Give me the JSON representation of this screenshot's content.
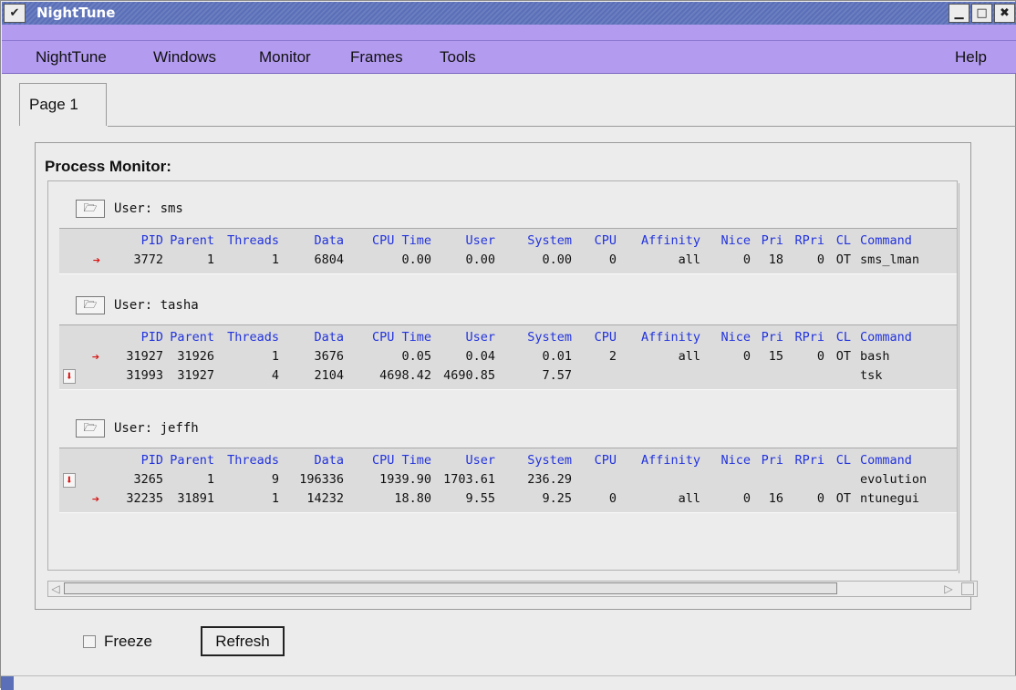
{
  "window": {
    "title": "NightTune",
    "menu_icon": "chevron-down-icon",
    "min_icon": "minimize-icon",
    "max_icon": "maximize-icon",
    "close_icon": "close-icon",
    "min_glyph": "▁",
    "max_glyph": "□",
    "close_glyph": "✖",
    "menu_glyph": "✔"
  },
  "menubar": {
    "items": [
      "NightTune",
      "Windows",
      "Monitor",
      "Frames",
      "Tools"
    ],
    "help": "Help"
  },
  "tabs": [
    {
      "label": "Page 1"
    }
  ],
  "process_monitor": {
    "title": "Process Monitor:",
    "columns": [
      "PID",
      "Parent",
      "Threads",
      "Data",
      "CPU Time",
      "User",
      "System",
      "CPU",
      "Affinity",
      "Nice",
      "Pri",
      "RPri",
      "CL",
      "Command"
    ],
    "groups": [
      {
        "user_label": "User: sms",
        "rows": [
          {
            "icon": "right-arrow-icon",
            "pid": "3772",
            "parent": "1",
            "threads": "1",
            "data": "6804",
            "cpu_time": "0.00",
            "user": "0.00",
            "system": "0.00",
            "cpu": "0",
            "affinity": "all",
            "nice": "0",
            "pri": "18",
            "rpri": "0",
            "cl": "OT",
            "command": "sms_lman"
          }
        ]
      },
      {
        "user_label": "User: tasha",
        "rows": [
          {
            "icon": "right-arrow-icon",
            "pid": "31927",
            "parent": "31926",
            "threads": "1",
            "data": "3676",
            "cpu_time": "0.05",
            "user": "0.04",
            "system": "0.01",
            "cpu": "2",
            "affinity": "all",
            "nice": "0",
            "pri": "15",
            "rpri": "0",
            "cl": "OT",
            "command": "bash"
          },
          {
            "icon": "down-arrow-icon",
            "pid": "31993",
            "parent": "31927",
            "threads": "4",
            "data": "2104",
            "cpu_time": "4698.42",
            "user": "4690.85",
            "system": "7.57",
            "cpu": "",
            "affinity": "",
            "nice": "",
            "pri": "",
            "rpri": "",
            "cl": "",
            "command": "tsk"
          }
        ]
      },
      {
        "user_label": "User: jeffh",
        "rows": [
          {
            "icon": "down-arrow-icon",
            "pid": "3265",
            "parent": "1",
            "threads": "9",
            "data": "196336",
            "cpu_time": "1939.90",
            "user": "1703.61",
            "system": "236.29",
            "cpu": "",
            "affinity": "",
            "nice": "",
            "pri": "",
            "rpri": "",
            "cl": "",
            "command": "evolution"
          },
          {
            "icon": "right-arrow-icon",
            "pid": "32235",
            "parent": "31891",
            "threads": "1",
            "data": "14232",
            "cpu_time": "18.80",
            "user": "9.55",
            "system": "9.25",
            "cpu": "0",
            "affinity": "all",
            "nice": "0",
            "pri": "16",
            "rpri": "0",
            "cl": "OT",
            "command": "ntunegui"
          }
        ]
      }
    ]
  },
  "controls": {
    "freeze_label": "Freeze",
    "freeze_checked": false,
    "refresh_label": "Refresh"
  },
  "colors": {
    "titlebar": "#5a6fb8",
    "menubar": "#b39bf0",
    "header_text": "#2233dd",
    "arrow": "#d81010"
  }
}
